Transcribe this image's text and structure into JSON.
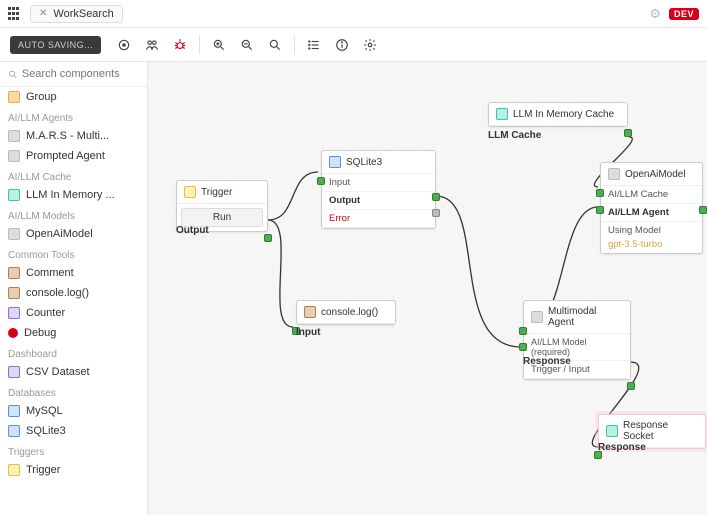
{
  "header": {
    "tab_title": "WorkSearch",
    "dev_badge": "DEV"
  },
  "toolbar": {
    "autosave": "AUTO SAVING..."
  },
  "sidebar": {
    "search_placeholder": "Search components",
    "top_item": "Group",
    "groups": [
      {
        "title": "AI/LLM Agents",
        "items": [
          {
            "label": "M.A.R.S - Multi...",
            "icon": "ico-gray"
          },
          {
            "label": "Prompted Agent",
            "icon": "ico-gray"
          }
        ]
      },
      {
        "title": "AI/LLM Cache",
        "items": [
          {
            "label": "LLM In Memory ...",
            "icon": "ico-teal"
          }
        ]
      },
      {
        "title": "AI/LLM Models",
        "items": [
          {
            "label": "OpenAiModel",
            "icon": "ico-gray"
          }
        ]
      },
      {
        "title": "Common Tools",
        "items": [
          {
            "label": "Comment",
            "icon": "ico-brown"
          },
          {
            "label": "console.log()",
            "icon": "ico-brown"
          },
          {
            "label": "Counter",
            "icon": "ico-purple"
          },
          {
            "label": "Debug",
            "icon": "ico-red-dot"
          }
        ]
      },
      {
        "title": "Dashboard",
        "items": [
          {
            "label": "CSV Dataset",
            "icon": "ico-purple"
          }
        ]
      },
      {
        "title": "Databases",
        "items": [
          {
            "label": "MySQL",
            "icon": "ico-blue"
          },
          {
            "label": "SQLite3",
            "icon": "ico-blue"
          }
        ]
      },
      {
        "title": "Triggers",
        "items": [
          {
            "label": "Trigger",
            "icon": "ico-yellow"
          }
        ]
      }
    ]
  },
  "canvas": {
    "nodes": {
      "trigger": {
        "title": "Trigger",
        "button": "Run",
        "out": "Output"
      },
      "sqlite": {
        "title": "SQLite3",
        "in": "Input",
        "out": "Output",
        "err": "Error"
      },
      "llmcache": {
        "title": "LLM In Memory Cache",
        "out": "LLM Cache"
      },
      "openai": {
        "title": "OpenAiModel",
        "cache": "AI/LLM Cache",
        "agent": "AI/LLM Agent",
        "using": "Using Model",
        "model": "gpt-3.5-turbo"
      },
      "console": {
        "title": "console.log()",
        "in": "Input"
      },
      "multi": {
        "title": "Multimodal Agent",
        "model": "AI/LLM Model (required)",
        "input": "Trigger / Input",
        "resp": "Response"
      },
      "socket": {
        "title": "Response Socket",
        "resp": "Response"
      }
    }
  }
}
